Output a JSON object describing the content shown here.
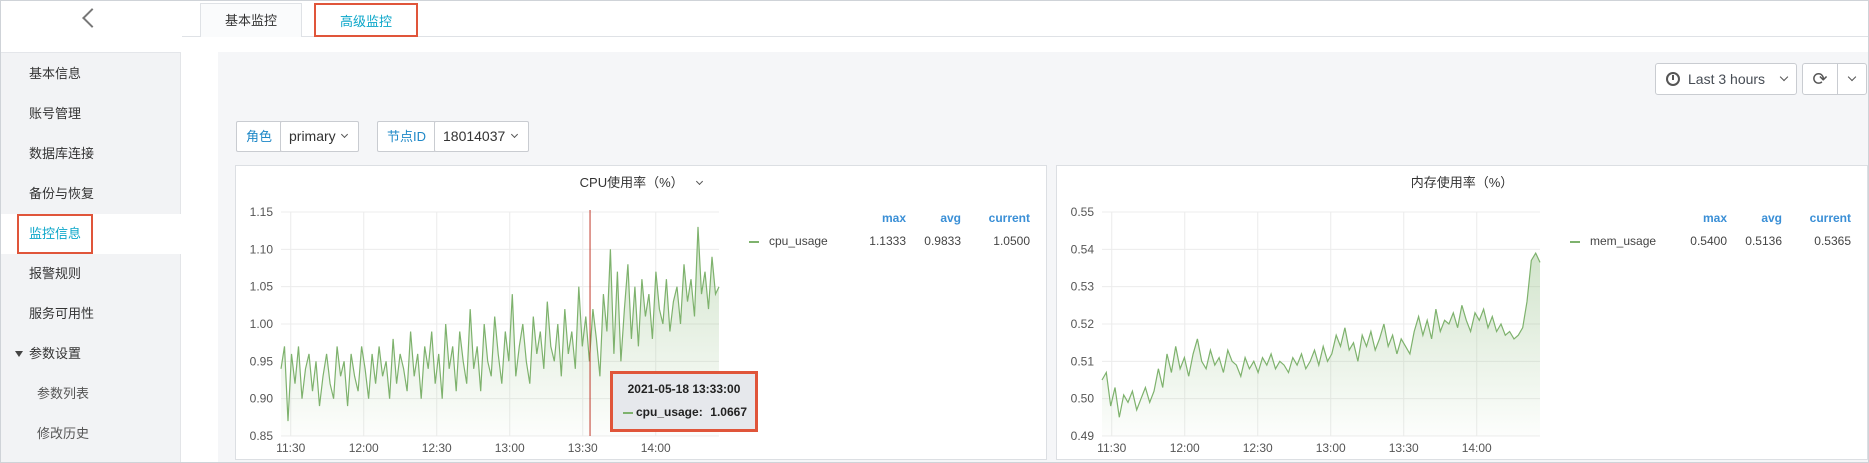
{
  "sidebar": {
    "items": [
      {
        "label": "基本信息"
      },
      {
        "label": "账号管理"
      },
      {
        "label": "数据库连接"
      },
      {
        "label": "备份与恢复"
      },
      {
        "label": "监控信息"
      },
      {
        "label": "报警规则"
      },
      {
        "label": "服务可用性"
      },
      {
        "label": "参数设置"
      },
      {
        "label": "参数列表"
      },
      {
        "label": "修改历史"
      }
    ]
  },
  "tabs": [
    {
      "label": "基本监控"
    },
    {
      "label": "高级监控"
    }
  ],
  "toolbar": {
    "time_range": "Last 3 hours"
  },
  "variables": {
    "role_label": "角色",
    "role_value": "primary",
    "node_label": "节点ID",
    "node_value": "18014037"
  },
  "colors": {
    "series": "#7eb26d",
    "accent": "#0aa6c9",
    "highlight": "#e0553a"
  },
  "panels": [
    {
      "title": "CPU使用率（%）",
      "legend": {
        "max_head": "max",
        "avg_head": "avg",
        "current_head": "current",
        "name": "cpu_usage",
        "max": "1.1333",
        "avg": "0.9833",
        "current": "1.0500"
      },
      "yticks": [
        "1.15",
        "1.10",
        "1.05",
        "1.00",
        "0.95",
        "0.90",
        "0.85"
      ],
      "xticks": [
        "11:30",
        "12:00",
        "12:30",
        "13:00",
        "13:30",
        "14:00"
      ]
    },
    {
      "title": "内存使用率（%）",
      "legend": {
        "max_head": "max",
        "avg_head": "avg",
        "current_head": "current",
        "name": "mem_usage",
        "max": "0.5400",
        "avg": "0.5136",
        "current": "0.5365"
      },
      "yticks": [
        "0.55",
        "0.54",
        "0.53",
        "0.52",
        "0.51",
        "0.50",
        "0.49"
      ],
      "xticks": [
        "11:30",
        "12:00",
        "12:30",
        "13:00",
        "13:30",
        "14:00"
      ]
    }
  ],
  "tooltip": {
    "time": "2021-05-18 13:33:00",
    "series": "cpu_usage:",
    "value": "1.0667"
  },
  "chart_data": [
    {
      "type": "line",
      "title": "CPU使用率（%）",
      "x_range": [
        "11:26",
        "14:26"
      ],
      "ylim": [
        0.85,
        1.15
      ],
      "series": [
        {
          "name": "cpu_usage",
          "values": [
            0.94,
            0.97,
            0.87,
            0.96,
            0.92,
            0.97,
            0.9,
            0.94,
            0.96,
            0.91,
            0.95,
            0.89,
            0.93,
            0.96,
            0.92,
            0.9,
            0.97,
            0.93,
            0.95,
            0.89,
            0.96,
            0.93,
            0.91,
            0.97,
            0.94,
            0.9,
            0.96,
            0.92,
            0.97,
            0.93,
            0.95,
            0.9,
            0.98,
            0.92,
            0.96,
            0.94,
            0.91,
            0.99,
            0.93,
            0.96,
            0.9,
            0.97,
            0.94,
            0.99,
            0.92,
            0.96,
            0.9,
            1.0,
            0.94,
            0.97,
            0.91,
            0.99,
            0.95,
            0.92,
            1.02,
            0.94,
            0.97,
            0.91,
            1.0,
            0.95,
            0.93,
            1.01,
            0.96,
            0.92,
            0.99,
            0.95,
            1.04,
            0.93,
            0.97,
            1.0,
            0.95,
            0.92,
            1.01,
            0.96,
            0.99,
            0.94,
            1.03,
            0.97,
            0.95,
            1.0,
            0.93,
            1.02,
            0.96,
            0.99,
            0.94,
            1.05,
            0.97,
            1.01,
            0.95,
            1.02,
            0.98,
            0.93,
            1.04,
            0.99,
            1.1,
            0.96,
            1.07,
            0.95,
            1.02,
            1.08,
            0.98,
            1.05,
            0.97,
            1.06,
            1.01,
            1.04,
            0.98,
            1.07,
            1.02,
            1.0,
            1.06,
            0.99,
            1.03,
            1.05,
            1.0,
            1.08,
            1.03,
            1.06,
            1.01,
            1.13,
            1.04,
            1.07,
            1.02,
            1.09,
            1.04,
            1.05
          ]
        }
      ]
    },
    {
      "type": "line",
      "title": "内存使用率（%）",
      "x_range": [
        "11:26",
        "14:26"
      ],
      "ylim": [
        0.49,
        0.55
      ],
      "series": [
        {
          "name": "mem_usage",
          "values": [
            0.505,
            0.507,
            0.498,
            0.503,
            0.495,
            0.501,
            0.499,
            0.502,
            0.497,
            0.5,
            0.503,
            0.499,
            0.502,
            0.508,
            0.503,
            0.512,
            0.507,
            0.514,
            0.508,
            0.511,
            0.506,
            0.512,
            0.516,
            0.51,
            0.508,
            0.513,
            0.509,
            0.511,
            0.507,
            0.513,
            0.51,
            0.509,
            0.506,
            0.511,
            0.508,
            0.51,
            0.507,
            0.511,
            0.509,
            0.512,
            0.508,
            0.51,
            0.509,
            0.507,
            0.511,
            0.509,
            0.512,
            0.508,
            0.51,
            0.513,
            0.509,
            0.514,
            0.51,
            0.512,
            0.517,
            0.514,
            0.519,
            0.513,
            0.515,
            0.51,
            0.517,
            0.514,
            0.518,
            0.513,
            0.516,
            0.52,
            0.514,
            0.517,
            0.512,
            0.516,
            0.514,
            0.512,
            0.518,
            0.522,
            0.517,
            0.521,
            0.516,
            0.524,
            0.518,
            0.521,
            0.52,
            0.523,
            0.519,
            0.525,
            0.521,
            0.518,
            0.523,
            0.521,
            0.524,
            0.519,
            0.522,
            0.518,
            0.52,
            0.517,
            0.518,
            0.516,
            0.517,
            0.519,
            0.526,
            0.537,
            0.539,
            0.5365
          ]
        }
      ]
    }
  ]
}
